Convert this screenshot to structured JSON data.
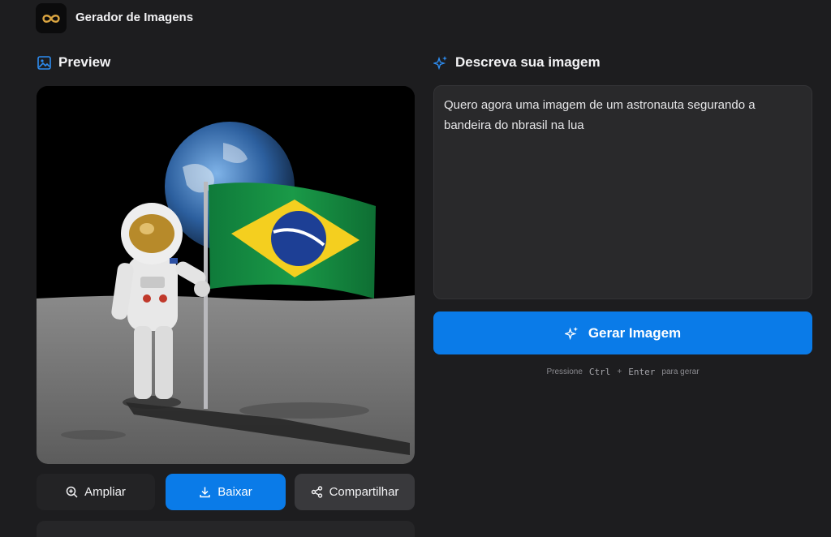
{
  "app": {
    "title": "Gerador de Imagens",
    "logo_icon": "infinity-icon",
    "accent": "#0a7be8"
  },
  "preview": {
    "heading": "Preview",
    "heading_icon": "image-icon",
    "image_description_icon": "generated-image"
  },
  "actions": {
    "zoom_label": "Ampliar",
    "zoom_icon": "zoom-in-icon",
    "download_label": "Baixar",
    "download_icon": "download-icon",
    "share_label": "Compartilhar",
    "share_icon": "share-icon"
  },
  "prompt": {
    "heading": "Descreva sua imagem",
    "heading_icon": "sparkles-icon",
    "value": "Quero agora uma imagem de um astronauta segurando a\nbandeira do nbrasil na lua"
  },
  "generate": {
    "label": "Gerar Imagem",
    "icon": "sparkles-icon"
  },
  "hint": {
    "press": "Pressione",
    "key1": "Ctrl",
    "plus": "+",
    "key2": "Enter",
    "suffix": "para gerar"
  }
}
